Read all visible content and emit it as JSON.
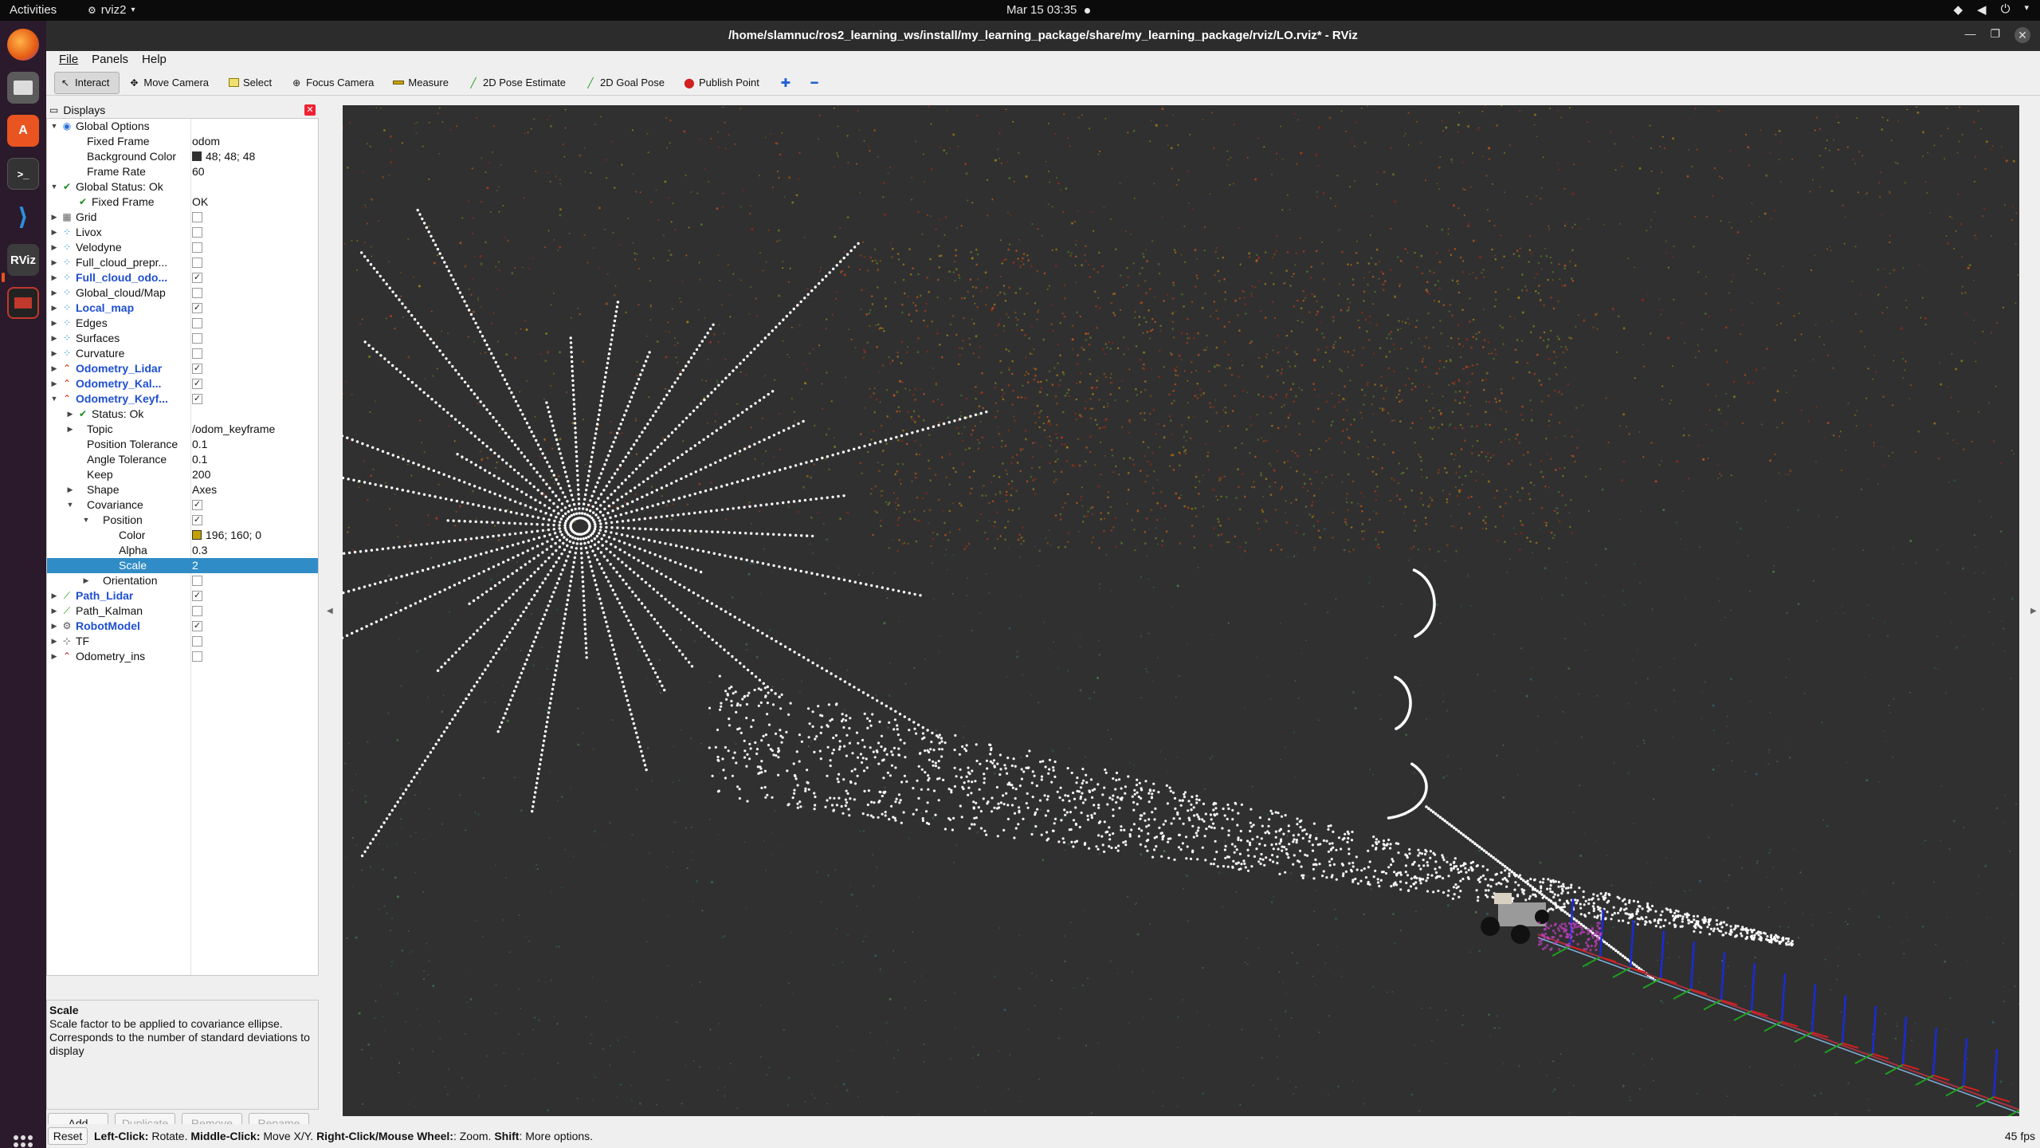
{
  "topbar": {
    "activities": "Activities",
    "app_name": "rviz2",
    "clock": "Mar 15  03:35"
  },
  "dock": {
    "apps": [
      "firefox-icon",
      "files-icon",
      "software-center-icon",
      "terminal-icon",
      "vscode-icon",
      "rviz-icon",
      "system-monitor-icon"
    ],
    "rviz_label": "RViz"
  },
  "window": {
    "title": "/home/slamnuc/ros2_learning_ws/install/my_learning_package/share/my_learning_package/rviz/LO.rviz* - RViz"
  },
  "menu": [
    "File",
    "Panels",
    "Help"
  ],
  "toolbar": [
    {
      "label": "Interact",
      "icon": "interact-icon",
      "active": true
    },
    {
      "label": "Move Camera",
      "icon": "move-camera-icon"
    },
    {
      "label": "Select",
      "icon": "select-icon"
    },
    {
      "label": "Focus Camera",
      "icon": "focus-camera-icon"
    },
    {
      "label": "Measure",
      "icon": "measure-icon"
    },
    {
      "label": "2D Pose Estimate",
      "icon": "pose-estimate-icon"
    },
    {
      "label": "2D Goal Pose",
      "icon": "goal-pose-icon"
    },
    {
      "label": "Publish Point",
      "icon": "publish-point-icon"
    }
  ],
  "displays": {
    "header": "Displays",
    "rows": [
      {
        "indent": 0,
        "arrow": "down",
        "icon": "globe-icon",
        "label": "Global Options",
        "value": ""
      },
      {
        "indent": 1,
        "arrow": "",
        "icon": "",
        "label": "Fixed Frame",
        "value": "odom"
      },
      {
        "indent": 1,
        "arrow": "",
        "icon": "",
        "label": "Background Color",
        "value": "48; 48; 48",
        "swatch": "#303030"
      },
      {
        "indent": 1,
        "arrow": "",
        "icon": "",
        "label": "Frame Rate",
        "value": "60"
      },
      {
        "indent": 0,
        "arrow": "down",
        "icon": "check-icon",
        "label": "Global Status: Ok",
        "value": ""
      },
      {
        "indent": 1,
        "arrow": "",
        "icon": "check-icon",
        "label": "Fixed Frame",
        "value": "OK"
      },
      {
        "indent": 0,
        "arrow": "right",
        "icon": "grid-icon",
        "label": "Grid",
        "checkbox": false
      },
      {
        "indent": 0,
        "arrow": "right",
        "icon": "pointcloud-icon",
        "label": "Livox",
        "checkbox": false
      },
      {
        "indent": 0,
        "arrow": "right",
        "icon": "pointcloud-icon",
        "label": "Velodyne",
        "checkbox": false
      },
      {
        "indent": 0,
        "arrow": "right",
        "icon": "pointcloud-icon",
        "label": "Full_cloud_prepr...",
        "checkbox": false
      },
      {
        "indent": 0,
        "arrow": "right",
        "icon": "pointcloud-icon",
        "label": "Full_cloud_odo...",
        "checkbox": true,
        "blue": true
      },
      {
        "indent": 0,
        "arrow": "right",
        "icon": "pointcloud-icon",
        "label": "Global_cloud/Map",
        "checkbox": false
      },
      {
        "indent": 0,
        "arrow": "right",
        "icon": "pointcloud-icon",
        "label": "Local_map",
        "checkbox": true,
        "blue": true
      },
      {
        "indent": 0,
        "arrow": "right",
        "icon": "pointcloud-icon",
        "label": "Edges",
        "checkbox": false
      },
      {
        "indent": 0,
        "arrow": "right",
        "icon": "pointcloud-icon",
        "label": "Surfaces",
        "checkbox": false
      },
      {
        "indent": 0,
        "arrow": "right",
        "icon": "pointcloud-icon",
        "label": "Curvature",
        "checkbox": false
      },
      {
        "indent": 0,
        "arrow": "right",
        "icon": "odometry-icon",
        "label": "Odometry_Lidar",
        "checkbox": true,
        "blue": true
      },
      {
        "indent": 0,
        "arrow": "right",
        "icon": "odometry-icon",
        "label": "Odometry_Kal...",
        "checkbox": true,
        "blue": true
      },
      {
        "indent": 0,
        "arrow": "down",
        "icon": "odometry-icon",
        "label": "Odometry_Keyf...",
        "checkbox": true,
        "blue": true
      },
      {
        "indent": 1,
        "arrow": "right",
        "icon": "check-icon",
        "label": "Status: Ok",
        "value": ""
      },
      {
        "indent": 1,
        "arrow": "right",
        "icon": "",
        "label": "Topic",
        "value": "/odom_keyframe"
      },
      {
        "indent": 1,
        "arrow": "",
        "icon": "",
        "label": "Position Tolerance",
        "value": "0.1"
      },
      {
        "indent": 1,
        "arrow": "",
        "icon": "",
        "label": "Angle Tolerance",
        "value": "0.1"
      },
      {
        "indent": 1,
        "arrow": "",
        "icon": "",
        "label": "Keep",
        "value": "200"
      },
      {
        "indent": 1,
        "arrow": "right",
        "icon": "",
        "label": "Shape",
        "value": "Axes"
      },
      {
        "indent": 1,
        "arrow": "down",
        "icon": "",
        "label": "Covariance",
        "checkbox": true
      },
      {
        "indent": 2,
        "arrow": "down",
        "icon": "",
        "label": "Position",
        "checkbox": true
      },
      {
        "indent": 3,
        "arrow": "",
        "icon": "",
        "label": "Color",
        "value": "196; 160; 0",
        "swatch": "#c4a000"
      },
      {
        "indent": 3,
        "arrow": "",
        "icon": "",
        "label": "Alpha",
        "value": "0.3"
      },
      {
        "indent": 3,
        "arrow": "",
        "icon": "",
        "label": "Scale",
        "value": "2",
        "selected": true
      },
      {
        "indent": 2,
        "arrow": "right",
        "icon": "",
        "label": "Orientation",
        "checkbox": false
      },
      {
        "indent": 0,
        "arrow": "right",
        "icon": "path-icon",
        "label": "Path_Lidar",
        "checkbox": true,
        "blue": true
      },
      {
        "indent": 0,
        "arrow": "right",
        "icon": "path-icon",
        "label": "Path_Kalman",
        "checkbox": false
      },
      {
        "indent": 0,
        "arrow": "right",
        "icon": "robot-model-icon",
        "label": "RobotModel",
        "checkbox": true,
        "blue": true
      },
      {
        "indent": 0,
        "arrow": "right",
        "icon": "tf-icon",
        "label": "TF",
        "checkbox": false
      },
      {
        "indent": 0,
        "arrow": "right",
        "icon": "odometry-icon",
        "label": "Odometry_ins",
        "checkbox": false
      }
    ]
  },
  "description": {
    "title": "Scale",
    "text": "Scale factor to be applied to covariance ellipse. Corresponds to the number of standard deviations to display"
  },
  "panel_buttons": {
    "add": "Add",
    "duplicate": "Duplicate",
    "remove": "Remove",
    "rename": "Rename"
  },
  "status": {
    "reset": "Reset",
    "left_key": "Left-Click:",
    "left_text": " Rotate. ",
    "middle_key": "Middle-Click:",
    "middle_text": " Move X/Y. ",
    "right_key": "Right-Click/Mouse Wheel:",
    "right_text": ": Zoom. ",
    "shift_key": "Shift",
    "shift_text": ": More options.",
    "fps": "45 fps"
  }
}
